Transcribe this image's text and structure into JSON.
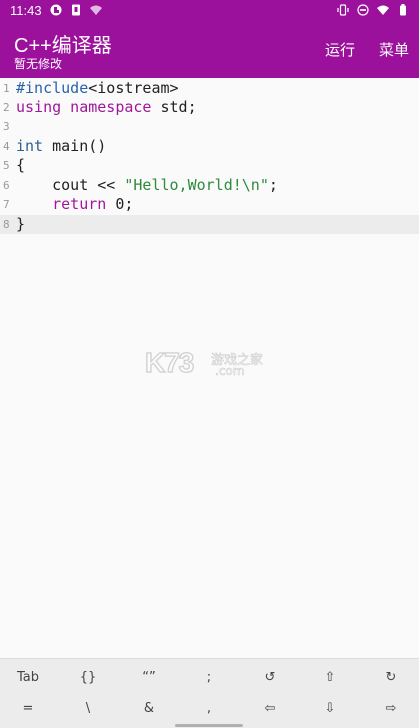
{
  "status_bar": {
    "time": "11:43",
    "left_icons": [
      "app-notification-icon",
      "sim-icon",
      "wifi-icon"
    ],
    "right_icons": [
      "vibrate-icon",
      "dnd-icon",
      "wifi-icon",
      "battery-icon"
    ]
  },
  "app_bar": {
    "title": "C++编译器",
    "subtitle": "暂无修改",
    "run_label": "运行",
    "menu_label": "菜单",
    "background": "#9c119c"
  },
  "editor": {
    "current_line": 8,
    "lines": [
      {
        "num": "1",
        "text": "#include<iostream>"
      },
      {
        "num": "2",
        "text": "using namespace std;"
      },
      {
        "num": "3",
        "text": ""
      },
      {
        "num": "4",
        "text": "int main()"
      },
      {
        "num": "5",
        "text": "{"
      },
      {
        "num": "6",
        "text": "    cout << \"Hello,World!\\n\";"
      },
      {
        "num": "7",
        "text": "    return 0;"
      },
      {
        "num": "8",
        "text": "}"
      }
    ]
  },
  "watermark": {
    "logo": "K73",
    "site_cn": "游戏之家",
    "site_domain": ".com"
  },
  "shortcut_keys": {
    "row1": [
      "Tab",
      "{}",
      "“”",
      ";",
      "↺",
      "⇧",
      "↻"
    ],
    "row2": [
      "=",
      "\\",
      "&",
      ",",
      "⇦",
      "⇩",
      "⇨"
    ]
  }
}
